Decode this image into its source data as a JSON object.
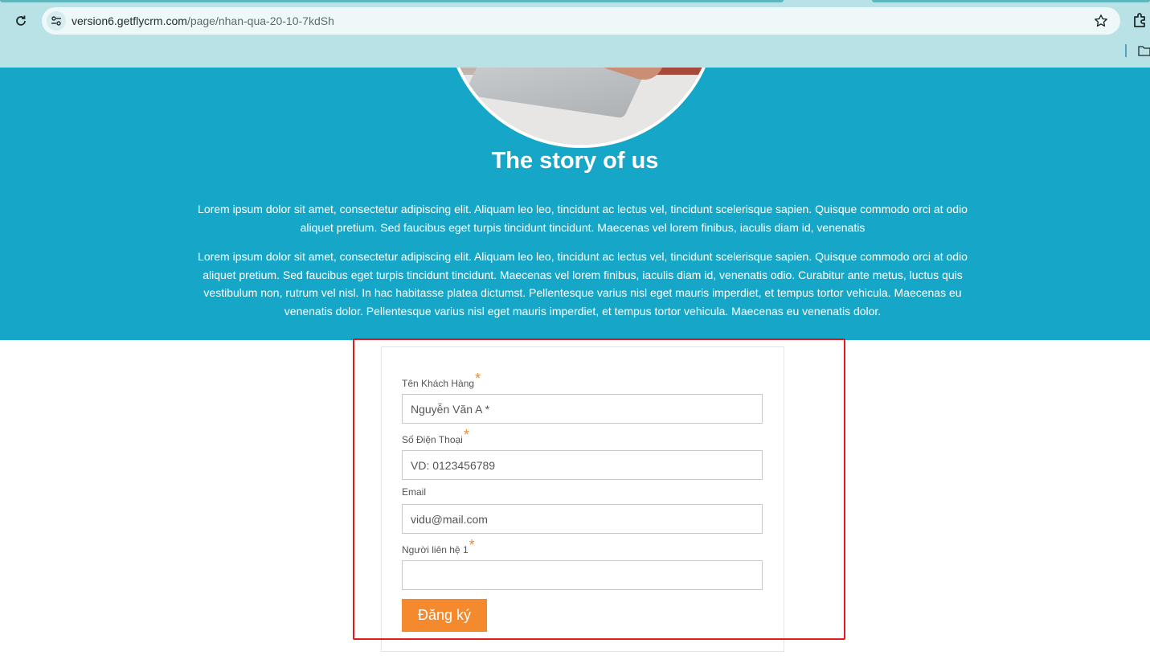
{
  "browser": {
    "url_host": "version6.getflycrm.com",
    "url_path": "/page/nhan-qua-20-10-7kdSh"
  },
  "hero": {
    "title": "The story of us",
    "paragraph_1": "Lorem ipsum dolor sit amet, consectetur adipiscing elit. Aliquam leo leo, tincidunt ac lectus vel, tincidunt scelerisque sapien. Quisque commodo orci at odio aliquet pretium. Sed faucibus eget turpis tincidunt tincidunt. Maecenas vel lorem finibus, iaculis diam id, venenatis",
    "paragraph_2": "Lorem ipsum dolor sit amet, consectetur adipiscing elit. Aliquam leo leo, tincidunt ac lectus vel, tincidunt scelerisque sapien. Quisque commodo orci at odio aliquet pretium. Sed faucibus eget turpis tincidunt tincidunt. Maecenas vel lorem finibus, iaculis diam id, venenatis odio. Curabitur ante metus, luctus quis vestibulum non, rutrum vel nisl. In hac habitasse platea dictumst. Pellentesque varius nisl eget mauris imperdiet, et tempus tortor vehicula. Maecenas eu venenatis dolor. Pellentesque varius nisl eget mauris imperdiet, et tempus tortor vehicula. Maecenas eu venenatis dolor."
  },
  "form": {
    "name_label": "Tên Khách Hàng",
    "name_placeholder": "Nguyễn Văn A *",
    "phone_label": "Số Điện Thoại",
    "phone_placeholder": "VD: 0123456789",
    "email_label": "Email",
    "email_placeholder": "vidu@mail.com",
    "contact_label": "Người liên hệ 1",
    "contact_placeholder": "",
    "required_mark": "*",
    "submit_label": "Đăng ký"
  },
  "colors": {
    "hero_bg": "#16a6c8",
    "submit_bg": "#f5892e",
    "required": "#f08c2c",
    "highlight_border": "#e01b1b"
  }
}
